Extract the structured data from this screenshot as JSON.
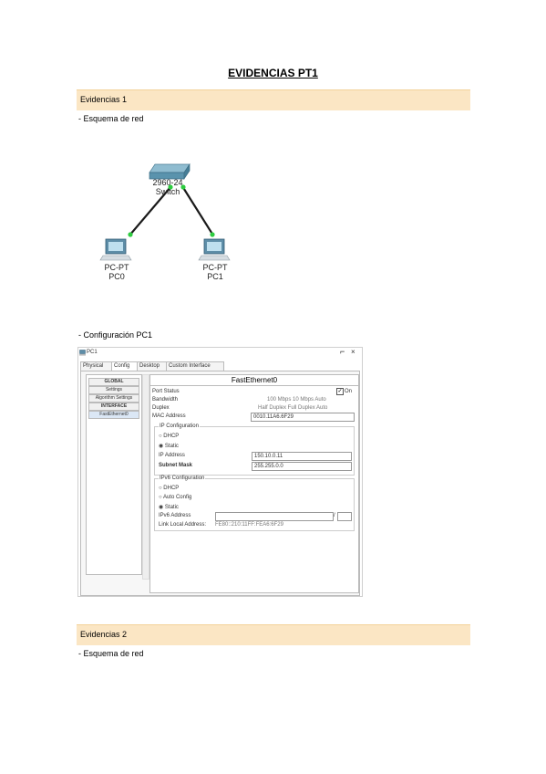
{
  "document": {
    "title": "EVIDENCIAS PT1",
    "sections": [
      {
        "heading": "Evidencias 1",
        "items": [
          "- Esquema de red",
          "- Configuración PC1"
        ]
      },
      {
        "heading": "Evidencias 2",
        "items": [
          "- Esquema de red"
        ]
      }
    ]
  },
  "topology": {
    "switch": {
      "model": "2960-24",
      "name": "Switch"
    },
    "pc0": {
      "model": "PC-PT",
      "name": "PC0"
    },
    "pc1": {
      "model": "PC-PT",
      "name": "PC1"
    },
    "link_color": "#1a1a1a",
    "port_color": "#2ecc40"
  },
  "window": {
    "title": "PC1",
    "min_glyph": "⌐",
    "close_glyph": "×",
    "tabs": [
      "Physical",
      "Config",
      "Desktop",
      "Custom Interface"
    ],
    "active_tab": "Config",
    "sidebar": [
      "GLOBAL",
      "Settings",
      "Algorithm Settings",
      "INTERFACE",
      "FastEthernet0"
    ],
    "panel_title": "FastEthernet0",
    "port_status_label": "Port Status",
    "port_status_value": "On",
    "bandwidth_label": "Bandwidth",
    "bandwidth_options": "100 Mbps  10 Mbps  Auto",
    "duplex_label": "Duplex",
    "duplex_options": "Half Duplex  Full Duplex  Auto",
    "mac_label": "MAC Address",
    "mac_value": "0010.11A6.6F29",
    "ip_config": {
      "title": "IP Configuration",
      "dhcp": "DHCP",
      "static": "Static",
      "ip_label": "IP Address",
      "ip_value": "150.10.0.11",
      "mask_label": "Subnet Mask",
      "mask_value": "255.255.0.0"
    },
    "ipv6_config": {
      "title": "IPv6 Configuration",
      "dhcp": "DHCP",
      "auto": "Auto Config",
      "static": "Static",
      "addr_label": "IPv6 Address",
      "addr_value": "",
      "prefix": "/",
      "link_local_label": "Link Local Address:",
      "link_local_value": "FE80::210:11FF:FEA6:6F29"
    }
  }
}
